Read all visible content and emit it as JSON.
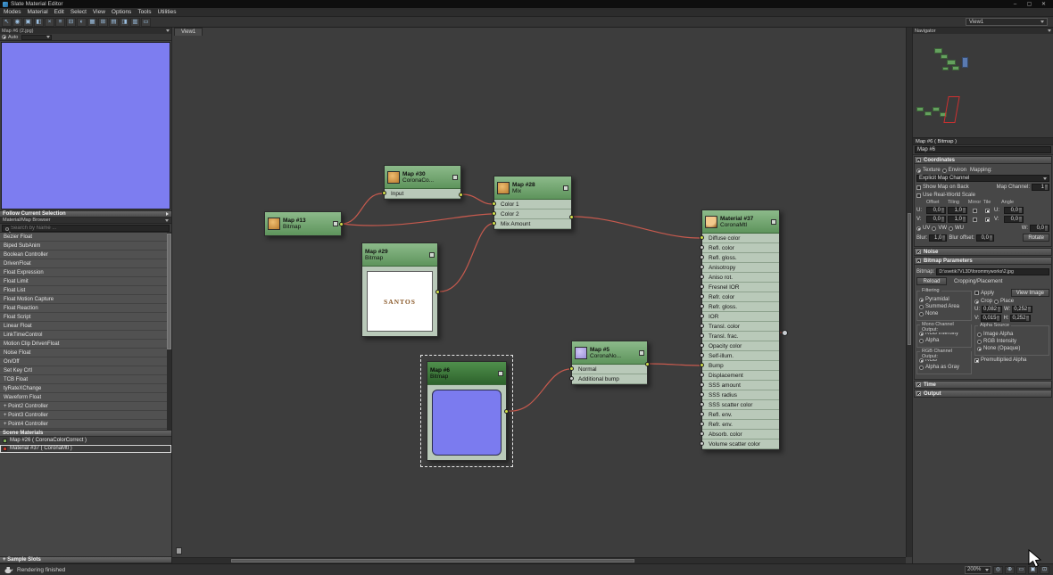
{
  "window": {
    "title": "Slate Material Editor",
    "minimize": "–",
    "maximize": "▢",
    "close": "✕"
  },
  "menu": {
    "items": [
      "Modes",
      "Material",
      "Edit",
      "Select",
      "View",
      "Options",
      "Tools",
      "Utilities"
    ]
  },
  "toolbar": {
    "icons": [
      {
        "name": "select-tool",
        "glyph": "↖"
      },
      {
        "name": "pick-material-from-object",
        "glyph": "◉"
      },
      {
        "name": "put-material-to-scene",
        "glyph": "▣"
      },
      {
        "name": "assign-material-to-selection",
        "glyph": "◧"
      },
      {
        "name": "delete-selected",
        "glyph": "×"
      },
      {
        "name": "move-children",
        "glyph": "≡"
      },
      {
        "name": "hide-unused-nodeslots",
        "glyph": "⊟"
      },
      {
        "name": "show-shaded-material-in-viewport",
        "glyph": "◐"
      },
      {
        "name": "show-background",
        "glyph": "▦"
      },
      {
        "name": "lay-out-all",
        "glyph": "⊞"
      },
      {
        "name": "lay-out-children",
        "glyph": "▤"
      },
      {
        "name": "material-map-browser-toggle",
        "glyph": "◨"
      },
      {
        "name": "parameter-editor-toggle",
        "glyph": "▥"
      },
      {
        "name": "select-by-material",
        "glyph": "▭"
      }
    ],
    "view_dropdown": "View1"
  },
  "canvas": {
    "tab": "View1"
  },
  "left_panel": {
    "preview_title": "Map #6 (2.jpg)",
    "auto_label": "Auto",
    "follow_bar": "Follow Current Selection",
    "browser_header": "Material/Map Browser",
    "search_placeholder": "Search by Name ...",
    "browser_items": [
      {
        "label": "Bezier Float"
      },
      {
        "label": "Biped SubAnim"
      },
      {
        "label": "Boolean Controller"
      },
      {
        "label": "DrivenFloat"
      },
      {
        "label": "Float Expression"
      },
      {
        "label": "Float Limit"
      },
      {
        "label": "Float List"
      },
      {
        "label": "Float Motion Capture"
      },
      {
        "label": "Float Reaction"
      },
      {
        "label": "Float Script"
      },
      {
        "label": "Linear Float"
      },
      {
        "label": "LinkTimeControl"
      },
      {
        "label": "Motion Clip DrivenFloat"
      },
      {
        "label": "Noise Float"
      },
      {
        "label": "On/Off"
      },
      {
        "label": "Set Key Crtl"
      },
      {
        "label": "TCB Float"
      },
      {
        "label": "tyRateXChange"
      },
      {
        "label": "Waveform Float"
      },
      {
        "label": "+ Point2 Controller"
      },
      {
        "label": "+ Point3 Controller"
      },
      {
        "label": "+ Point4 Controller"
      }
    ],
    "scene_materials_header": "Scene Materials",
    "scene_materials": [
      {
        "label": "Map #26 ( CoronaColorCorrect )",
        "icon_color": "#7fae5a",
        "state": ""
      },
      {
        "label": "Material #37 ( CoronaMtl )",
        "icon_color": "#c0392b",
        "state": "selected"
      }
    ],
    "sample_slots_header": "+ Sample Slots"
  },
  "nodes": {
    "map13": {
      "name": "Map #13",
      "type": "Bitmap"
    },
    "map30": {
      "name": "Map #30",
      "type": "CoronaCo...",
      "slots": [
        {
          "label": "Input",
          "state": "connected"
        }
      ]
    },
    "map28": {
      "name": "Map #28",
      "type": "Mix",
      "slots": [
        {
          "label": "Color 1",
          "state": "connected"
        },
        {
          "label": "Color 2",
          "state": "connected"
        },
        {
          "label": "Mix Amount",
          "state": "connected"
        }
      ]
    },
    "map29": {
      "name": "Map #29",
      "type": "Bitmap",
      "image_text": "SANTOS"
    },
    "map6": {
      "name": "Map #6",
      "type": "Bitmap"
    },
    "map5": {
      "name": "Map #5",
      "type": "CoronaNo...",
      "slots": [
        {
          "label": "Normal",
          "state": "connected"
        },
        {
          "label": "Additional bump",
          "state": ""
        }
      ]
    },
    "material37": {
      "name": "Material #37",
      "type": "CoronaMtl",
      "slots": [
        {
          "label": "Diffuse color",
          "state": "connected"
        },
        {
          "label": "Refl. color",
          "state": ""
        },
        {
          "label": "Refl. gloss.",
          "state": ""
        },
        {
          "label": "Anisotropy",
          "state": ""
        },
        {
          "label": "Aniso rot.",
          "state": ""
        },
        {
          "label": "Fresnel IOR",
          "state": ""
        },
        {
          "label": "Refr. color",
          "state": ""
        },
        {
          "label": "Refr. gloss.",
          "state": ""
        },
        {
          "label": "IOR",
          "state": ""
        },
        {
          "label": "Transl. color",
          "state": ""
        },
        {
          "label": "Transl. frac.",
          "state": ""
        },
        {
          "label": "Opacity color",
          "state": ""
        },
        {
          "label": "Self-illum.",
          "state": ""
        },
        {
          "label": "Bump",
          "state": "connected"
        },
        {
          "label": "Displacement",
          "state": ""
        },
        {
          "label": "SSS amount",
          "state": ""
        },
        {
          "label": "SSS radius",
          "state": ""
        },
        {
          "label": "SSS scatter color",
          "state": ""
        },
        {
          "label": "Refl. env.",
          "state": ""
        },
        {
          "label": "Refr. env.",
          "state": ""
        },
        {
          "label": "Absorb. color",
          "state": ""
        },
        {
          "label": "Volume scatter color",
          "state": ""
        }
      ]
    }
  },
  "right_panel": {
    "navigator_title": "Navigator",
    "param_header": "Map #6  ( Bitmap )",
    "name_value": "Map #6",
    "coordinates": {
      "title": "Coordinates",
      "texture": "Texture",
      "environ": "Environ",
      "mapping_label": "Mapping:",
      "mapping_value": "Explicit Map Channel",
      "show_map_on_back": "Show Map on Back",
      "map_channel_label": "Map Channel:",
      "map_channel_value": "1",
      "use_real_world_scale": "Use Real-World Scale",
      "col_offset": "Offset",
      "col_tiling": "Tiling",
      "col_mirror": "Mirror",
      "col_tile": "Tile",
      "col_angle": "Angle",
      "u_label": "U:",
      "v_label": "V:",
      "w_label": "W:",
      "u_offset": "0,0",
      "u_tiling": "1,0",
      "u_angle": "0,0",
      "v_offset": "0,0",
      "v_tiling": "1,0",
      "v_angle": "0,0",
      "uv": "UV",
      "vw": "VW",
      "wu": "WU",
      "w_angle": "0,0",
      "blur_label": "Blur:",
      "blur_value": "1,0",
      "blur_offset_label": "Blur offset:",
      "blur_offset_value": "0,0",
      "rotate_button": "Rotate"
    },
    "noise_title": "Noise",
    "bitmap_parameters": {
      "title": "Bitmap Parameters",
      "bitmap_label": "Bitmap:",
      "bitmap_path": "D:\\svetik7VL3D\\forommyworks\\2.jpg",
      "reload_button": "Reload",
      "cropping_label": "Cropping/Placement",
      "apply": "Apply",
      "view_image_button": "View Image",
      "crop": "Crop",
      "place": "Place",
      "filtering_title": "Filtering",
      "pyramidal": "Pyramidal",
      "summed_area": "Summed Area",
      "none": "None",
      "u_label": "U:",
      "u_value": "0,082",
      "v_label": "V:",
      "v_value": "0,015",
      "w_label": "W:",
      "w_value": "0,252",
      "h_label": "H:",
      "h_value": "0,252",
      "mono_output_title": "Mono Channel Output:",
      "rgb_intensity": "RGB Intensity",
      "alpha": "Alpha",
      "rgb_output_title": "RGB Channel Output:",
      "rgb": "RGB",
      "alpha_as_gray": "Alpha as Gray",
      "alpha_source_title": "Alpha Source",
      "image_alpha": "Image Alpha",
      "rgb_intensity2": "RGB Intensity",
      "none_opaque": "None (Opaque)",
      "premultiplied_alpha": "Premultiplied Alpha"
    },
    "time_title": "Time",
    "output_title": "Output"
  },
  "status_bar": {
    "message": "Rendering finished",
    "zoom": "200%",
    "icons": [
      {
        "name": "pan-tool",
        "glyph": "◎"
      },
      {
        "name": "zoom-tool",
        "glyph": "⊕"
      },
      {
        "name": "zoom-region-tool",
        "glyph": "▭"
      },
      {
        "name": "zoom-extents-tool",
        "glyph": "▣"
      },
      {
        "name": "zoom-extents-selected-tool",
        "glyph": "⊡"
      }
    ]
  },
  "colors": {
    "wire": "#c75a4e",
    "node_header_green": "#6f9f6e",
    "node_body": "#b9c9b9",
    "selected_header_green": "#3f7a3f",
    "preview_blue": "#7d7df0",
    "socket_yellow": "#d2e04a"
  }
}
